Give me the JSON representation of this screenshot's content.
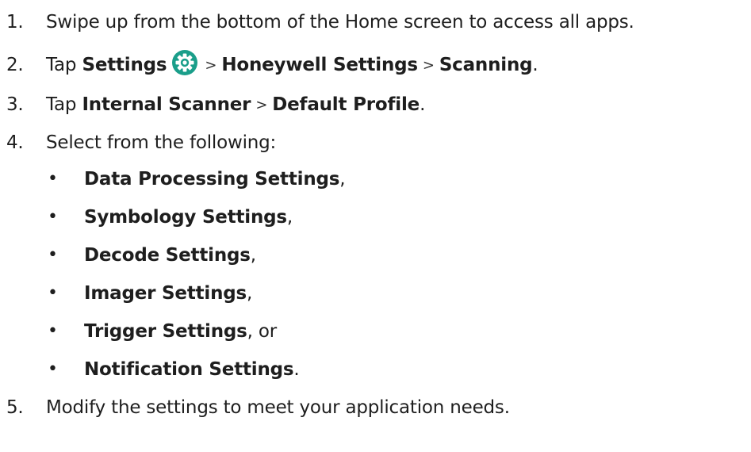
{
  "steps": [
    {
      "num": "1.",
      "text": "Swipe up from the bottom of the Home screen to access all apps."
    },
    {
      "num": "2.",
      "prefix": "Tap ",
      "item1": "Settings",
      "sep1": ">",
      "item2": "Honeywell Settings",
      "sep2": ">",
      "item3": "Scanning",
      "suffix": "."
    },
    {
      "num": "3.",
      "prefix": "Tap ",
      "item1": "Internal Scanner",
      "sep1": ">",
      "item2": "Default Profile",
      "suffix": "."
    },
    {
      "num": "4.",
      "text": "Select from the following:"
    },
    {
      "num": "5.",
      "text": "Modify the settings to meet your application needs."
    }
  ],
  "bullets": [
    {
      "dot": "•",
      "label": "Data Processing Settings",
      "tail": ","
    },
    {
      "dot": "•",
      "label": "Symbology Settings",
      "tail": ","
    },
    {
      "dot": "•",
      "label": "Decode Settings",
      "tail": ","
    },
    {
      "dot": "•",
      "label": "Imager Settings",
      "tail": ","
    },
    {
      "dot": "•",
      "label": "Trigger Settings",
      "tail": ", or"
    },
    {
      "dot": "•",
      "label": "Notification Settings",
      "tail": "."
    }
  ],
  "icons": {
    "settings_icon": "gear-icon",
    "settings_icon_color": "#1a9e8a"
  }
}
